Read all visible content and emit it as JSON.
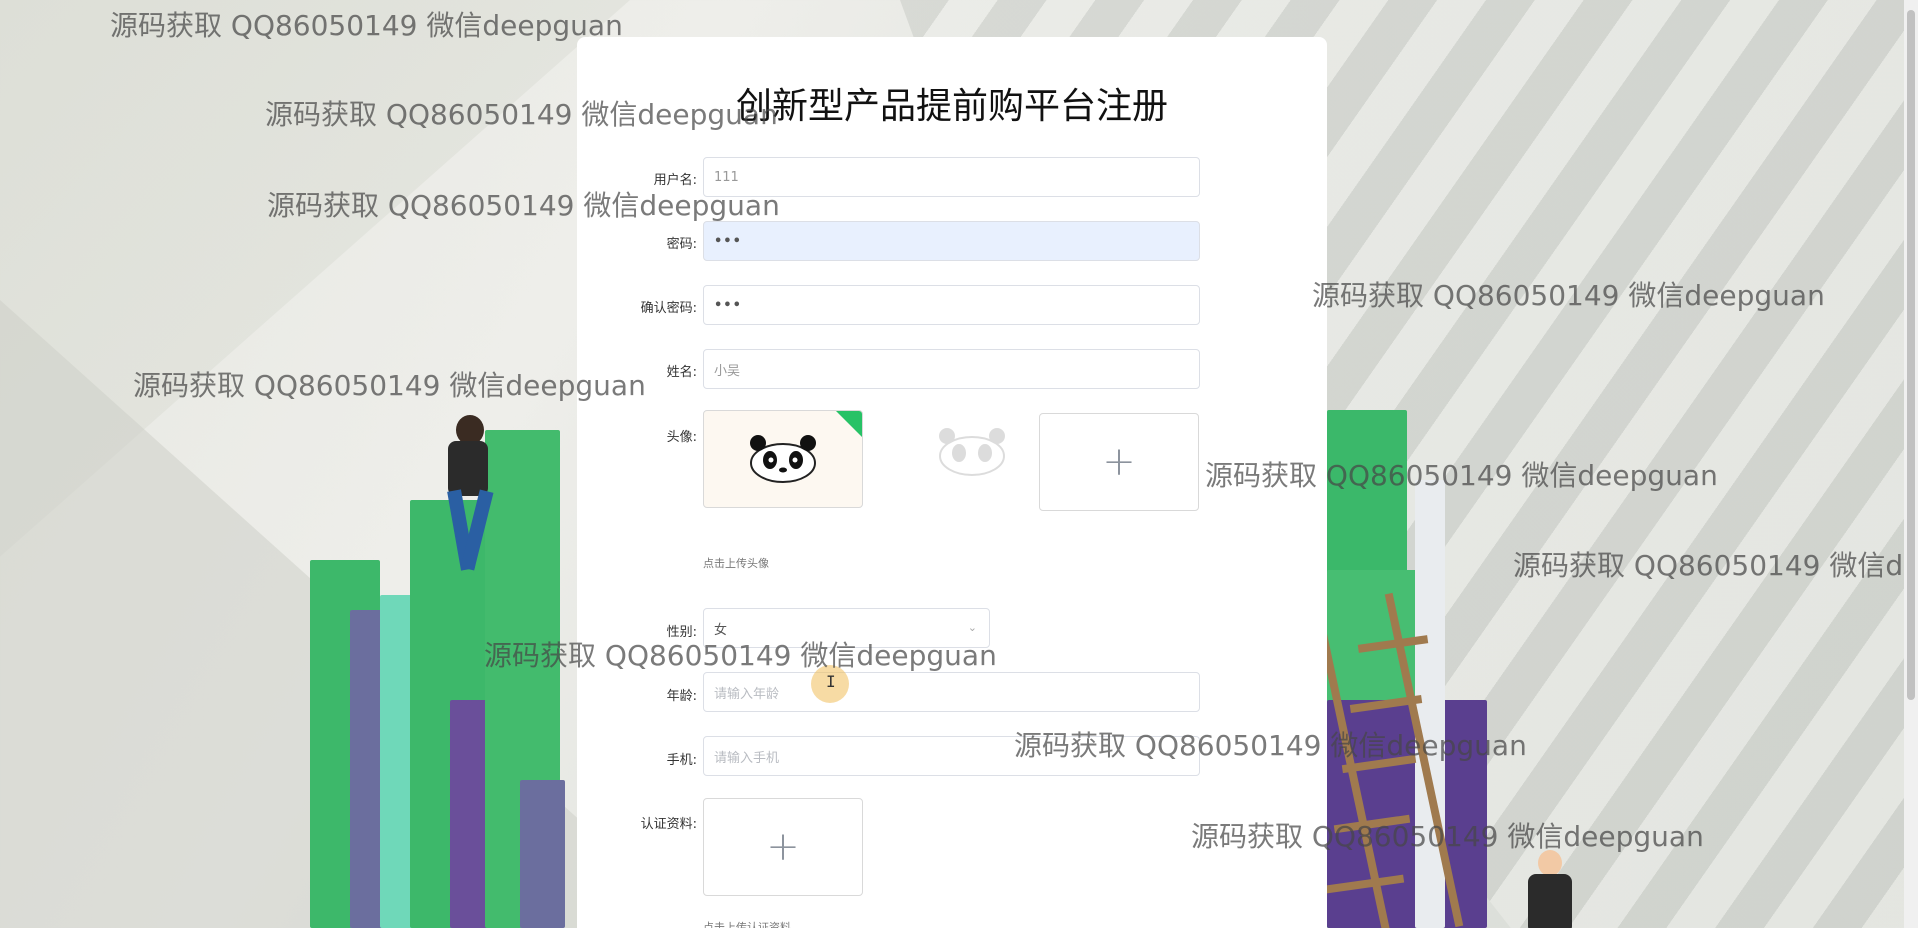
{
  "form": {
    "title": "创新型产品提前购平台注册",
    "username": {
      "label": "用户名:",
      "value": "111"
    },
    "password": {
      "label": "密码:",
      "value": "•••"
    },
    "confirm_password": {
      "label": "确认密码:",
      "value": "•••"
    },
    "name": {
      "label": "姓名:",
      "value": "小吴"
    },
    "avatar": {
      "label": "头像:",
      "hint": "点击上传头像"
    },
    "gender": {
      "label": "性别:",
      "value": "女"
    },
    "age": {
      "label": "年龄:",
      "placeholder": "请输入年龄"
    },
    "phone": {
      "label": "手机:",
      "placeholder": "请输入手机"
    },
    "certificate": {
      "label": "认证资料:",
      "hint": "点击上传认证资料"
    }
  },
  "watermark_text": "源码获取 QQ86050149 微信deepguan",
  "watermark_text_cut": "源码获取 QQ86050149 微信d",
  "icons": {
    "plus": "+",
    "select_arrow": "⌄",
    "cursor": "I"
  },
  "colors": {
    "accent_green": "#27c266",
    "focused_field": "#e8f0fe"
  }
}
